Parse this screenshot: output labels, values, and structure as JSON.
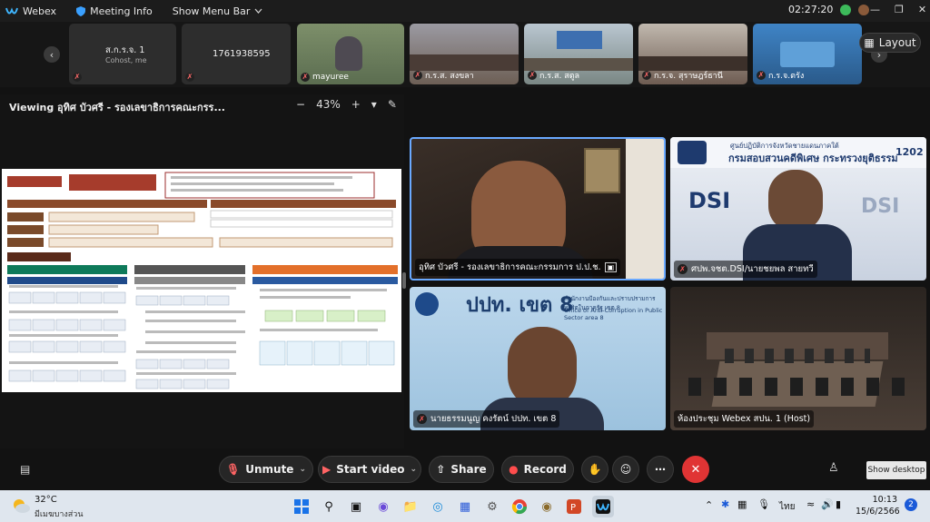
{
  "topbar": {
    "app_name": "Webex",
    "meeting_info": "Meeting Info",
    "show_menu_bar": "Show Menu Bar",
    "timer": "02:27:20"
  },
  "thumbnails": [
    {
      "name": "ส.ก.ร.จ. 1",
      "sub": "Cohost, me",
      "type": "text"
    },
    {
      "name": "1761938595",
      "sub": "",
      "type": "text"
    },
    {
      "name": "mayuree",
      "type": "video",
      "color": "#6b7f5a"
    },
    {
      "name": "ก.ร.ส. สงขลา",
      "type": "video",
      "color": "#8a7a6a"
    },
    {
      "name": "ก.ร.ส. สตูล",
      "type": "video",
      "color": "#7c8a8a"
    },
    {
      "name": "ก.ร.จ. สุราษฎร์ธานี",
      "type": "video",
      "color": "#857060"
    },
    {
      "name": "ก.ร.จ.ตรัง",
      "type": "video",
      "color": "#5a7ea0"
    }
  ],
  "layout_label": "Layout",
  "share": {
    "viewing": "Viewing อุทิศ บัวศรี - รองเลขาธิการคณะกรร...",
    "zoom": "43%"
  },
  "videos": [
    {
      "name": "อุทิศ บัวศรี - รองเลขาธิการคณะกรรมการ ป.ป.ช.",
      "mic": false
    },
    {
      "name": "ศปพ.จชต.DSI/นายชยพล สายทวี",
      "mic": true
    },
    {
      "name": "นายธรรมนูญ คงรัตน์ ปปท. เขต 8",
      "mic": true
    },
    {
      "name": "ห้องประชุม Webex สปน. 1 (Host)",
      "mic": false
    }
  ],
  "video_text": {
    "dsi_banner_line1": "ศูนย์ปฏิบัติการจังหวัดชายแดนภาคใต้",
    "dsi_banner_line2": "กรมสอบสวนคดีพิเศษ กระทรวงยุติธรรม",
    "dsi_call": "1202",
    "dsi_word": "DSI",
    "ppt_title": "ปปท. เขต 8",
    "ppt_sub1": "สำนักงานป้องกันและปราบปรามการทุจริตในภาครัฐ เขต 8",
    "ppt_sub2": "Office of Anti-Corruption in Public Sector area 8"
  },
  "controls": {
    "unmute": "Unmute",
    "start_video": "Start video",
    "share": "Share",
    "record": "Record",
    "show_desktop": "Show desktop"
  },
  "taskbar": {
    "temp": "32°C",
    "weather": "มีเมฆบางส่วน",
    "lang": "ไทย",
    "time": "10:13",
    "date": "15/6/2566",
    "badge": "2"
  }
}
